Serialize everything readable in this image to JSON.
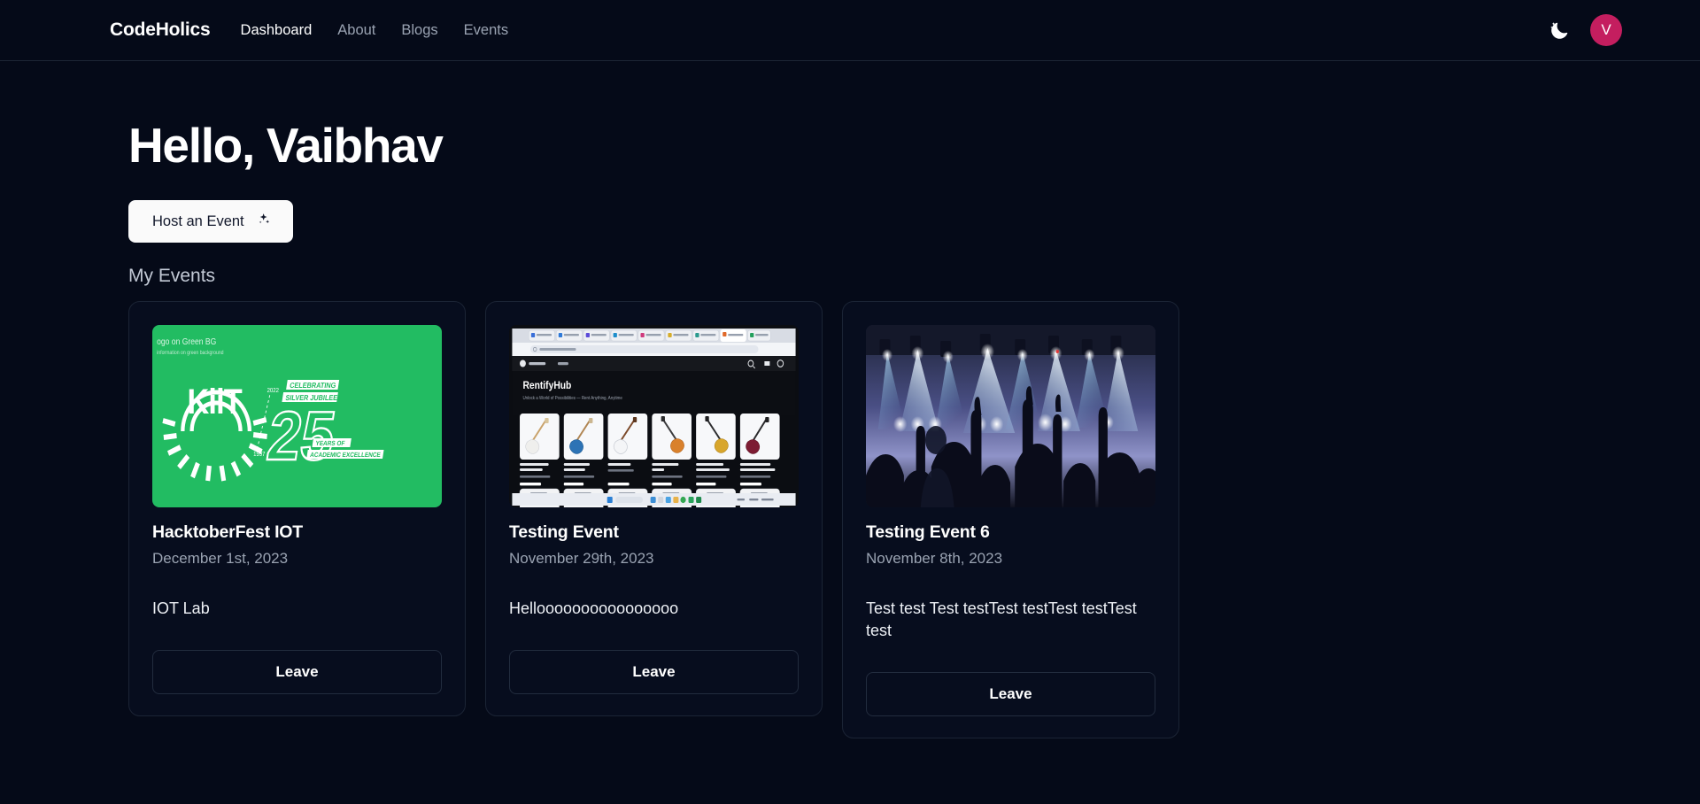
{
  "navbar": {
    "brand": "CodeHolics",
    "links": [
      {
        "label": "Dashboard",
        "active": true
      },
      {
        "label": "About",
        "active": false
      },
      {
        "label": "Blogs",
        "active": false
      },
      {
        "label": "Events",
        "active": false
      }
    ],
    "theme_toggle_icon": "moon-stars-icon",
    "avatar_initial": "V",
    "avatar_color": "#c41e5f"
  },
  "main": {
    "greeting": "Hello, Vaibhav",
    "host_button": {
      "label": "Host an Event",
      "icon": "sparkles-icon"
    },
    "section_title": "My Events"
  },
  "events": [
    {
      "title": "HacktoberFest IOT",
      "date": "December 1st, 2023",
      "description": "IOT Lab",
      "action_label": "Leave",
      "thumbnail": {
        "kind": "kiit-silver-jubilee-logo",
        "background": "#22bc62",
        "caption_line1": "ogo on Green BG",
        "caption_line2": "information on green background",
        "logo_text": "KiiT",
        "year_start": "1997",
        "year_end": "2022",
        "celebrating": "CELEBRATING",
        "jubilee": "SILVER JUBILEE",
        "big_number": "25",
        "years_of": "YEARS OF",
        "excellence": "ACADEMIC EXCELLENCE"
      }
    },
    {
      "title": "Testing Event",
      "date": "November 29th, 2023",
      "description": "Helloooooooooooooooo",
      "action_label": "Leave",
      "thumbnail": {
        "kind": "browser-screenshot-rentifyhub",
        "site_name": "RentifyHub",
        "site_tagline": "Unlock a World of Possibilities — Rent Anything, Anytime",
        "nav_brand": "RNTH",
        "nav_link": "Home",
        "products": [
          {
            "name": "Fender Player Stratocaster HSS",
            "meta": "Electric Guitar / Fender",
            "price": "$275.00 /day",
            "button": "Rent Now"
          },
          {
            "name": "Squier Bullet Stratocaster",
            "meta": "Electric Guitar / Squier",
            "price": "$75.00 /day",
            "button": "Rent Now"
          },
          {
            "name": "Ibanez AZES40",
            "meta": "Mint Green, Fender",
            "price": "$180.00 /day",
            "button": "Read more"
          },
          {
            "name": "Yamaha Pacifica 112V/M",
            "meta": "Electric Guitar / Yamaha",
            "price": "$140.00 /day",
            "button": "Rent Now"
          },
          {
            "name": "Gibson Custom Historic '57 Les Paul...",
            "meta": "Electric Guitar / Gibson",
            "price": "$480.00 /day",
            "button": "Rent Now"
          },
          {
            "name": "Fender American Performer Telecaster...",
            "meta": "Electric Guitar / Fender",
            "price": "$240.00 /day",
            "button": "Read more"
          }
        ]
      }
    },
    {
      "title": "Testing Event 6",
      "date": "November 8th, 2023",
      "description": "Test test Test testTest testTest testTest test",
      "action_label": "Leave",
      "thumbnail": {
        "kind": "concert-crowd-photo",
        "alt": "Crowd with raised hands at a concert with blue stage lights"
      }
    }
  ]
}
